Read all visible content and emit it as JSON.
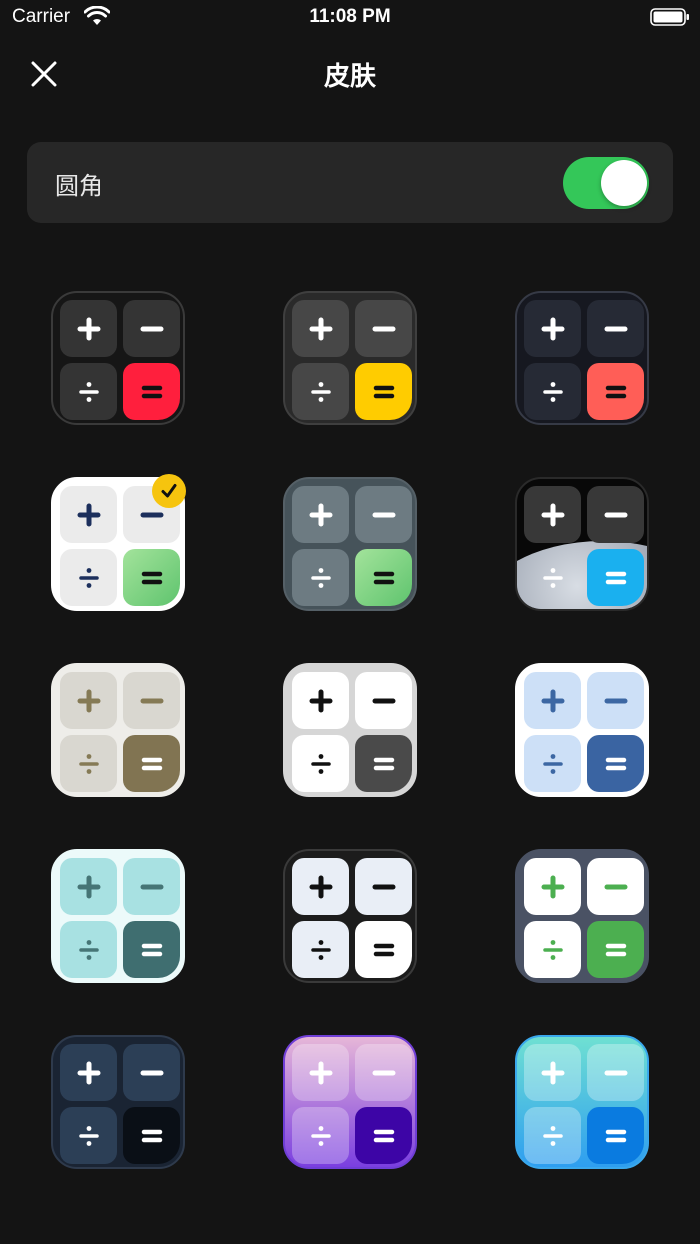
{
  "status": {
    "carrier": "Carrier",
    "time": "11:08 PM"
  },
  "nav": {
    "title": "皮肤",
    "close_icon": "close-icon"
  },
  "settings": {
    "rounded_label": "圆角",
    "rounded_enabled": true,
    "toggle_color": "#34c759"
  },
  "selected_index": 3,
  "skins": [
    {
      "bg": "#161616",
      "border": "#3a3a3a",
      "k": "#343434",
      "ks": "#ffffff",
      "e": "#ff1f3d",
      "es": "#111111"
    },
    {
      "bg": "#2a2a2a",
      "border": "#3f3f3f",
      "k": "#474747",
      "ks": "#ffffff",
      "e": "#ffcc00",
      "es": "#111111"
    },
    {
      "bg": "#161820",
      "border": "#363a46",
      "k": "#262a35",
      "ks": "#ffffff",
      "e": "#ff5e57",
      "es": "#111111"
    },
    {
      "bg": "#ffffff",
      "border": "#ffffff",
      "k": "#ebebeb",
      "ks": "#1c2f5c",
      "e": "linear-gradient(135deg,#a3e39b,#5fc46e)",
      "es": "#111111"
    },
    {
      "bg": "#46535a",
      "border": "#556067",
      "k": "#6d7b82",
      "ks": "#ffffff",
      "e": "linear-gradient(135deg,#a3e39b,#5fc46e)",
      "es": "#111111"
    },
    {
      "bg": "#080808",
      "border": "#2a2a2a",
      "k": "#383838",
      "ks": "#ffffff",
      "e": "#1ab0ef",
      "es": "#ffffff",
      "moon": true
    },
    {
      "bg": "#eeede9",
      "border": "#eeede9",
      "k": "#d9d7d0",
      "ks": "#857a55",
      "e": "#817452",
      "es": "#ffffff"
    },
    {
      "bg": "#d6d6d6",
      "border": "#d6d6d6",
      "k": "#ffffff",
      "ks": "#111111",
      "e": "#4a4a4a",
      "es": "#ffffff"
    },
    {
      "bg": "#ffffff",
      "border": "#ffffff",
      "k": "#cde0f7",
      "ks": "#3c67a3",
      "e": "#3a64a2",
      "es": "#ffffff"
    },
    {
      "bg": "#ecfafa",
      "border": "#ecfafa",
      "k": "#a8e1e2",
      "ks": "#467576",
      "e": "#3f6e70",
      "es": "#ffffff"
    },
    {
      "bg": "#1c1c1c",
      "border": "#3a3a3a",
      "k": "#e9eef6",
      "ks": "#111111",
      "e": "#ffffff",
      "es": "#111111"
    },
    {
      "bg": "#4a5264",
      "border": "#4a5264",
      "k": "#ffffff",
      "ks": "#4caf50",
      "e": "#4caf50",
      "es": "#ffffff"
    },
    {
      "bg": "#1a2433",
      "border": "#2e3a4c",
      "k": "#2c3f56",
      "ks": "#ffffff",
      "e": "#0a0f16",
      "es": "#ffffff"
    },
    {
      "bg": "linear-gradient(180deg,#e6b6d8,#7a3fe0)",
      "border": "#6f3ed6",
      "k": "rgba(255,255,255,0.28)",
      "ks": "#ffffff",
      "e": "#3d05a6",
      "es": "#ffffff"
    },
    {
      "bg": "linear-gradient(180deg,#6fe0d2,#2e9ef0)",
      "border": "#3aa8ec",
      "k": "rgba(255,255,255,0.30)",
      "ks": "#ffffff",
      "e": "#0a7be0",
      "es": "#ffffff"
    }
  ]
}
